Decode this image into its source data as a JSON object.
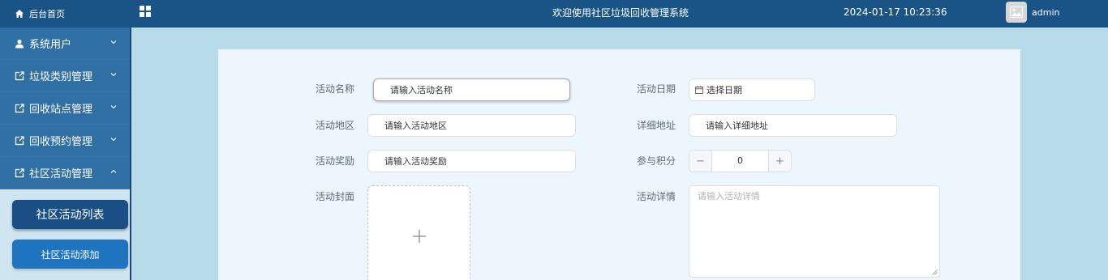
{
  "header": {
    "home_label": "后台首页",
    "title": "欢迎使用社区垃圾回收管理系统",
    "datetime": "2024-01-17 10:23:36",
    "username": "admin"
  },
  "sidebar": {
    "items": [
      {
        "label": "系统用户",
        "icon": "user-icon",
        "expanded": false
      },
      {
        "label": "垃圾类别管理",
        "icon": "edit-icon",
        "expanded": false
      },
      {
        "label": "回收站点管理",
        "icon": "edit-icon",
        "expanded": false
      },
      {
        "label": "回收预约管理",
        "icon": "edit-icon",
        "expanded": false
      },
      {
        "label": "社区活动管理",
        "icon": "edit-icon",
        "expanded": true
      }
    ],
    "submenu": {
      "active_label": "社区活动列表",
      "add_label": "社区活动添加"
    }
  },
  "form": {
    "name": {
      "label": "活动名称",
      "placeholder": "请输入活动名称"
    },
    "date": {
      "label": "活动日期",
      "placeholder": "选择日期"
    },
    "region": {
      "label": "活动地区",
      "placeholder": "请输入活动地区"
    },
    "address": {
      "label": "详细地址",
      "placeholder": "请输入详细地址"
    },
    "reward": {
      "label": "活动奖励",
      "placeholder": "请输入活动奖励"
    },
    "points": {
      "label": "参与积分",
      "value": "0",
      "minus": "−",
      "plus": "+"
    },
    "cover": {
      "label": "活动封面",
      "upload_symbol": "+"
    },
    "detail": {
      "label": "活动详情",
      "placeholder": "请输入活动详情"
    }
  },
  "colors": {
    "topbar": "#1a5487",
    "sidebar": "#3170a4",
    "background": "#b7dbe8",
    "panel": "#edf6fc",
    "active_submenu": "#1a4f85",
    "secondary_submenu": "#1f74bf"
  }
}
